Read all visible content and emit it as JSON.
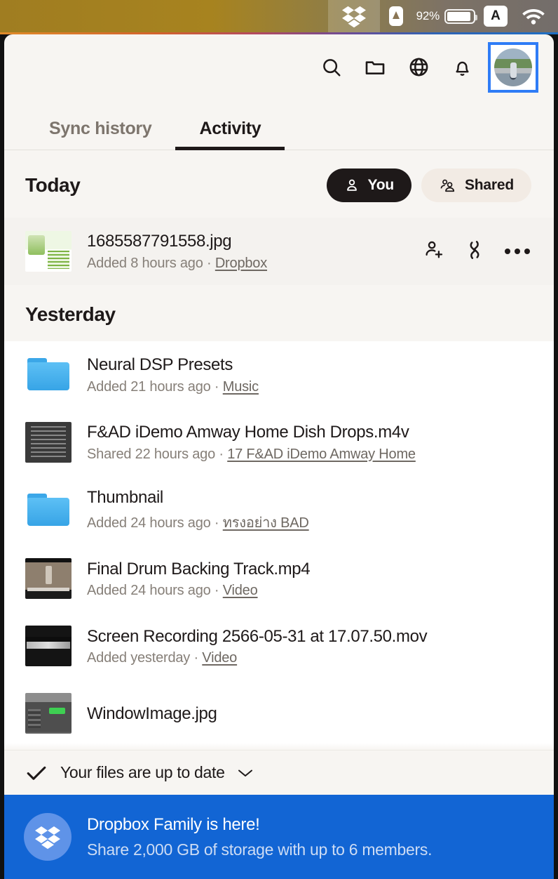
{
  "menubar": {
    "dropbox_icon": "dropbox-icon",
    "app_icon": "triangle-app-icon",
    "battery_percent": "92%",
    "input_source": "A",
    "wifi_icon": "wifi-icon"
  },
  "toolbar": {
    "items": [
      {
        "name": "search-icon",
        "label": "Search"
      },
      {
        "name": "folder-icon",
        "label": "Folder"
      },
      {
        "name": "globe-icon",
        "label": "Web"
      },
      {
        "name": "bell-icon",
        "label": "Notifications"
      }
    ],
    "avatar_label": "Account avatar",
    "avatar_focus_color": "#2f7cf6"
  },
  "tabs": [
    {
      "label": "Sync history",
      "active": false
    },
    {
      "label": "Activity",
      "active": true
    }
  ],
  "sections": [
    {
      "title": "Today",
      "filters": [
        {
          "label": "You",
          "icon": "person-icon",
          "selected": true
        },
        {
          "label": "Shared",
          "icon": "people-icon",
          "selected": false
        }
      ],
      "rows": [
        {
          "name": "1685587791558.jpg",
          "action": "Added 8 hours ago",
          "separator": "·",
          "location": "Dropbox",
          "thumb": "flyer",
          "highlighted": true,
          "actions": [
            {
              "name": "share-person-add-icon"
            },
            {
              "name": "copy-link-icon"
            },
            {
              "name": "more-options-icon"
            }
          ]
        }
      ]
    },
    {
      "title": "Yesterday",
      "rows": [
        {
          "name": "Neural DSP Presets",
          "action": "Added 21 hours ago",
          "separator": "·",
          "location": "Music",
          "thumb": "folder",
          "highlighted": false
        },
        {
          "name": "F&AD iDemo Amway Home Dish Drops.m4v",
          "action": "Shared 22 hours ago",
          "separator": "·",
          "location": "17 F&AD iDemo Amway Home",
          "thumb": "dark",
          "highlighted": false
        },
        {
          "name": "Thumbnail",
          "action": "Added 24 hours ago",
          "separator": "·",
          "location": "ทรงอย่าง BAD",
          "thumb": "folder",
          "highlighted": false
        },
        {
          "name": "Final Drum Backing Track.mp4",
          "action": "Added 24 hours ago",
          "separator": "·",
          "location": "Video",
          "thumb": "drum",
          "highlighted": false
        },
        {
          "name": "Screen Recording 2566-05-31 at 17.07.50.mov",
          "action": "Added yesterday",
          "separator": "·",
          "location": "Video",
          "thumb": "screenrec",
          "highlighted": false
        },
        {
          "name": "WindowImage.jpg",
          "action": "",
          "separator": "",
          "location": "",
          "thumb": "daw",
          "highlighted": false
        }
      ]
    }
  ],
  "status": {
    "icon": "checkmark-icon",
    "text": "Your files are up to date",
    "chevron": "chevron-down-icon"
  },
  "promo": {
    "logo": "dropbox-logo-icon",
    "title": "Dropbox Family is here!",
    "subtitle": "Share 2,000 GB of storage with up to 6 members.",
    "background": "#1265d4"
  }
}
